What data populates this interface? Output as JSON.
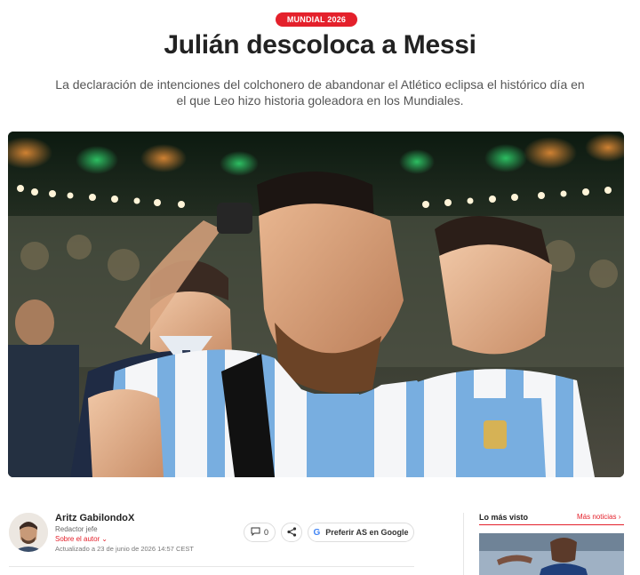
{
  "article": {
    "kicker": "MUNDIAL 2026",
    "title": "Julián descoloca a Messi",
    "subtitle": "La declaración de intenciones del colchonero de abandonar el Atlético eclipsa el histórico día en el que Leo hizo historia goleadora en los Mundiales."
  },
  "author": {
    "name": "Aritz Gabilondo",
    "social": "X",
    "role": "Redactor jefe",
    "about_label": "Sobre el autor",
    "updated": "Actualizado a 23 de junio de 2026 14:57 CEST"
  },
  "actions": {
    "comment_count": "0",
    "google_label": "Preferir AS en Google",
    "google_icon_letter": "G"
  },
  "sidebar": {
    "heading": "Lo más visto",
    "more_link": "Más noticias"
  },
  "colors": {
    "accent": "#e4202b"
  },
  "icons": [
    "x-logo-icon",
    "comment-icon",
    "share-icon",
    "google-icon",
    "chevron-down-icon",
    "chevron-right-icon"
  ]
}
